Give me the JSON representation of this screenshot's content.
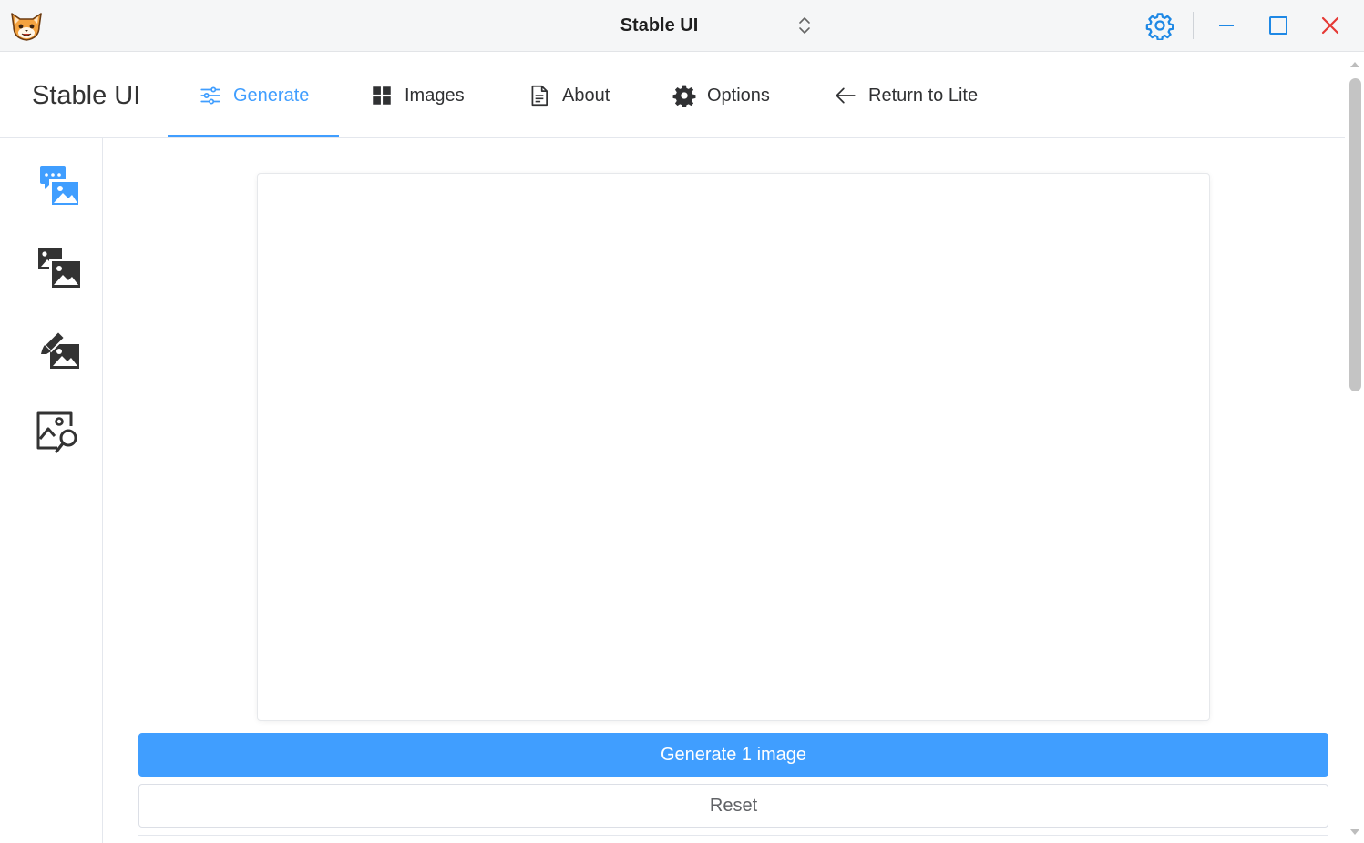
{
  "window": {
    "title": "Stable UI",
    "icons": {
      "app": "cat-logo-icon",
      "title_switcher": "chevron-up-down-icon",
      "settings": "gear-icon",
      "minimize": "minimize-icon",
      "maximize": "maximize-icon",
      "close": "close-icon"
    },
    "colors": {
      "settings_icon": "#1e88e5",
      "close_icon": "#e53935",
      "window_controls": "#1e88e5"
    }
  },
  "nav": {
    "brand": "Stable UI",
    "active_tab": "Generate",
    "items": [
      {
        "label": "Generate",
        "icon": "sliders-icon"
      },
      {
        "label": "Images",
        "icon": "grid-icon"
      },
      {
        "label": "About",
        "icon": "document-icon"
      },
      {
        "label": "Options",
        "icon": "cog-icon"
      },
      {
        "label": "Return to Lite",
        "icon": "arrow-left-icon"
      }
    ]
  },
  "sidebar": {
    "active": "text-to-image",
    "items": [
      {
        "id": "text-to-image",
        "icon": "text-to-image-icon"
      },
      {
        "id": "image-to-image",
        "icon": "image-to-image-icon"
      },
      {
        "id": "inpainting",
        "icon": "inpainting-icon"
      },
      {
        "id": "image-search",
        "icon": "image-search-icon"
      }
    ]
  },
  "main": {
    "generate_label": "Generate 1 image",
    "reset_label": "Reset"
  },
  "colors": {
    "accent": "#409eff",
    "text": "#303133",
    "border": "#e4e7ed"
  }
}
